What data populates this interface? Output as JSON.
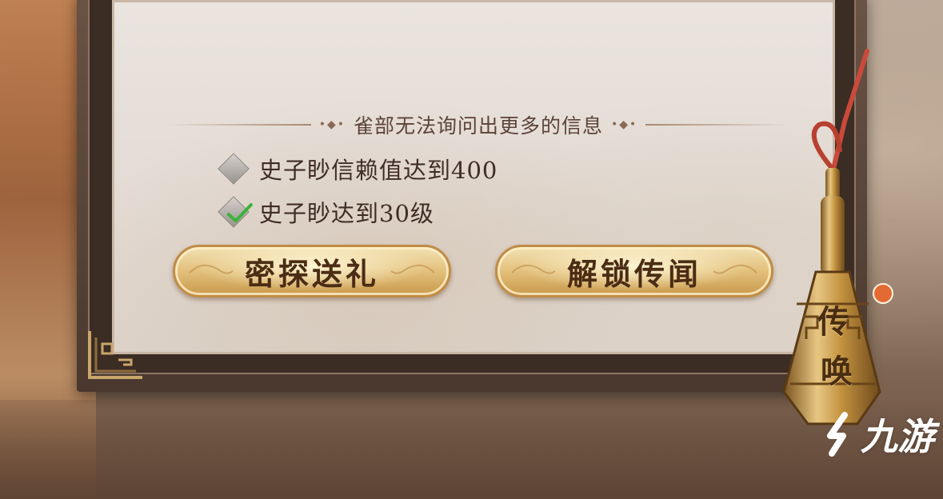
{
  "dialog": {
    "title": "雀部无法询问出更多的信息",
    "conditions": [
      {
        "text": "史子眇信赖值达到400",
        "met": false
      },
      {
        "text": "史子眇达到30级",
        "met": true
      }
    ]
  },
  "buttons": {
    "gift": "密探送礼",
    "unlock_rumor": "解锁传闻"
  },
  "bell": {
    "label_top": "传",
    "label_bottom": "唤",
    "has_notification": true
  },
  "watermark": {
    "text": "九游"
  },
  "colors": {
    "accent_gold": "#e3c07b",
    "check_green": "#3bb33b",
    "notify_orange": "#e36a32"
  }
}
